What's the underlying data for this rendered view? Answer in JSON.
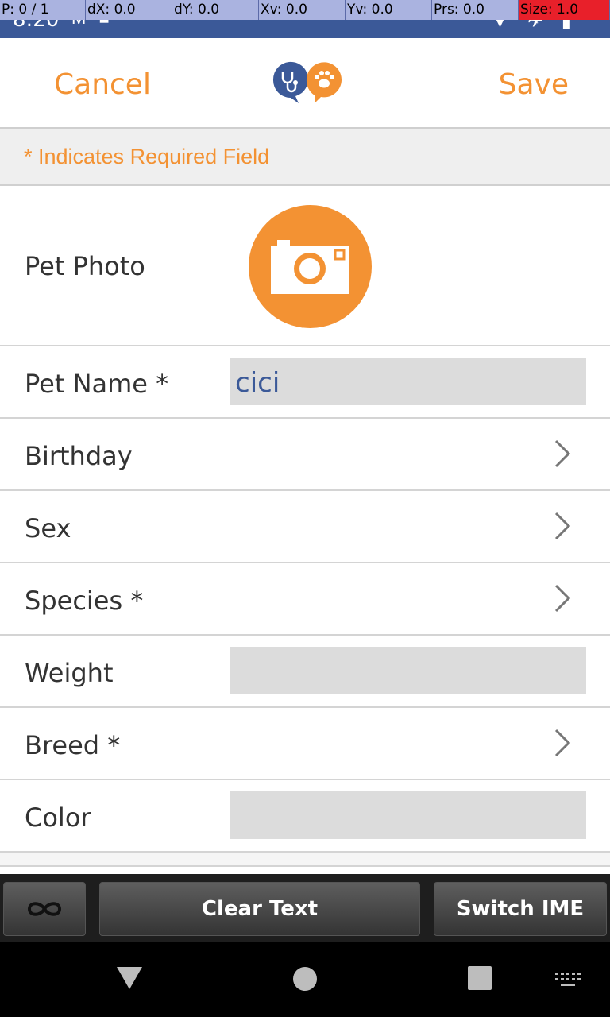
{
  "status_bar": {
    "time": "8:20",
    "left_icons": [
      "gmail-icon",
      "car-icon"
    ],
    "right_icons": [
      "wifi-icon",
      "airplane-icon",
      "battery-icon"
    ],
    "background": "#3b5998"
  },
  "debug_overlay": {
    "p": "P: 0 / 1",
    "dx": "dX: 0.0",
    "dy": "dY: 0.0",
    "xv": "Xv: 0.0",
    "yv": "Yv: 0.0",
    "prs": "Prs: 0.0",
    "size": "Size: 1.0"
  },
  "header": {
    "cancel_label": "Cancel",
    "save_label": "Save",
    "logo_icons": [
      "stethoscope-icon",
      "paw-icon"
    ],
    "accent_color": "#f39233",
    "logo_blue": "#3b5998"
  },
  "required_note": "* Indicates Required Field",
  "form": {
    "photo_label": "Pet Photo",
    "name_label": "Pet Name *",
    "name_value": "cici",
    "birthday_label": "Birthday",
    "sex_label": "Sex",
    "species_label": "Species *",
    "weight_label": "Weight",
    "weight_value": "",
    "breed_label": "Breed *",
    "color_label": "Color",
    "color_value": ""
  },
  "keyboard_bar": {
    "infinity_icon": "infinity-icon",
    "clear_text_label": "Clear Text",
    "switch_ime_label": "Switch IME"
  },
  "nav_bar": {
    "icons": [
      "back-triangle-icon",
      "home-circle-icon",
      "recents-square-icon",
      "keyboard-icon"
    ]
  }
}
